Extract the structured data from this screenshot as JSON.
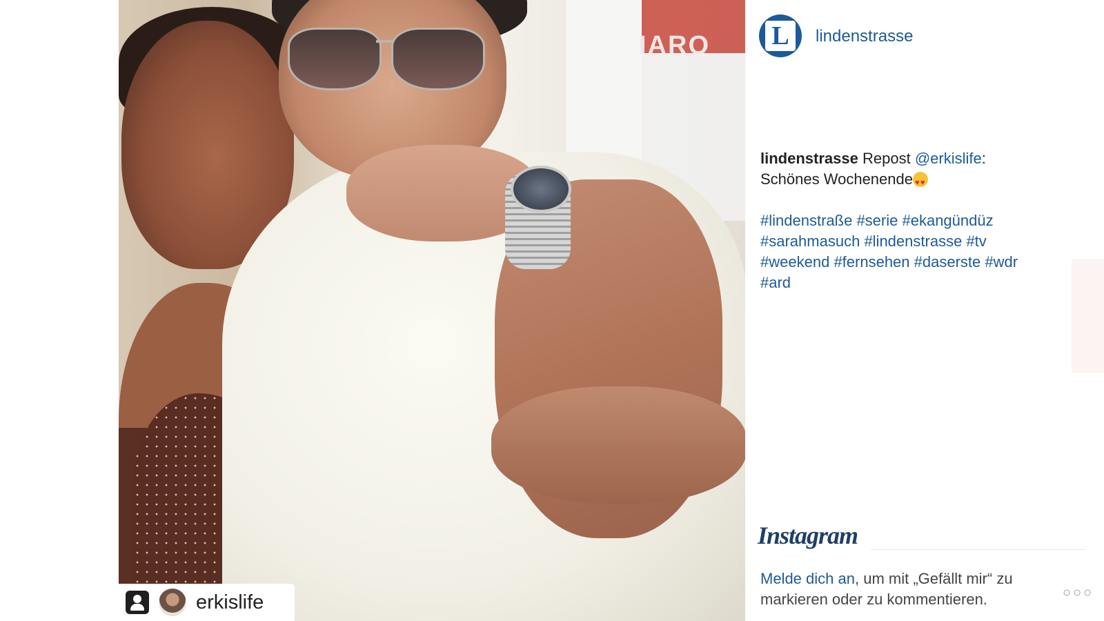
{
  "post": {
    "photo_alt": "Photo",
    "background_sign": "IARO",
    "credit_username": "erkislife"
  },
  "panel": {
    "account": "lindenstrasse",
    "avatar_letter": "L",
    "caption": {
      "user": "lindenstrasse",
      "text_before_mention": "Repost",
      "mention": "@erkislife",
      "text_after_mention": ":",
      "line2": "Schönes Wochenende"
    },
    "hashtags_lines": [
      [
        "#lindenstraße",
        "#serie",
        "#ekangündüz"
      ],
      [
        "#sarahmasuch",
        "#lindenstrasse",
        "#tv"
      ],
      [
        "#weekend",
        "#fernsehen",
        "#daserste",
        "#wdr"
      ],
      [
        "#ard"
      ]
    ],
    "brand": "Instagram",
    "login_link": "Melde dich an",
    "login_text": ", um mit „Gefällt mir“ zu markieren oder zu kommentieren.",
    "more_label": "○○○"
  },
  "colors": {
    "link": "#1e5a96",
    "brand": "#1f3f66"
  }
}
